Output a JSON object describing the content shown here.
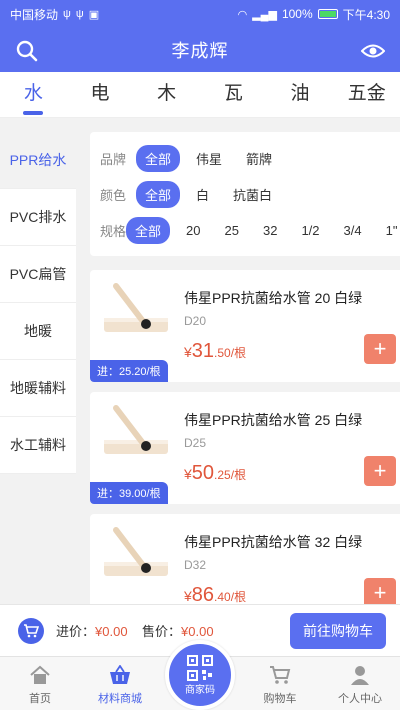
{
  "status_bar": {
    "carrier": "中国移动",
    "battery": "100%",
    "time": "下午4:30"
  },
  "header": {
    "title": "李成辉"
  },
  "category_tabs": [
    "水",
    "电",
    "木",
    "瓦",
    "油",
    "五金"
  ],
  "sidebar": {
    "items": [
      "PPR给水",
      "PVC排水",
      "PVC扁管",
      "地暖",
      "地暖辅料",
      "水工辅料"
    ]
  },
  "filters": {
    "brand": {
      "label": "品牌",
      "options": [
        "全部",
        "伟星",
        "箭牌"
      ]
    },
    "color": {
      "label": "颜色",
      "options": [
        "全部",
        "白",
        "抗菌白"
      ]
    },
    "spec": {
      "label": "规格",
      "options": [
        "全部",
        "20",
        "25",
        "32",
        "1/2",
        "3/4",
        "1\""
      ]
    }
  },
  "products": [
    {
      "name": "伟星PPR抗菌给水管 20 白绿",
      "code": "D20",
      "currency": "¥",
      "price_int": "31",
      "price_rest": ".50/根",
      "cost": "进：25.20/根"
    },
    {
      "name": "伟星PPR抗菌给水管 25 白绿",
      "code": "D25",
      "currency": "¥",
      "price_int": "50",
      "price_rest": ".25/根",
      "cost": "进：39.00/根"
    },
    {
      "name": "伟星PPR抗菌给水管 32 白绿",
      "code": "D32",
      "currency": "¥",
      "price_int": "86",
      "price_rest": ".40/根",
      "cost": ""
    }
  ],
  "add_symbol": "+",
  "cart_bar": {
    "cost_label": "进价：",
    "cost_value": "¥0.00",
    "sale_label": "售价：",
    "sale_value": "¥0.00",
    "checkout_label": "前往购物车"
  },
  "bottom_nav": {
    "home": "首页",
    "mall": "材料商城",
    "qr": "商家码",
    "cart": "购物车",
    "profile": "个人中心"
  },
  "colors": {
    "primary": "#5a6ff0",
    "accent_blue": "#4a63e8",
    "price_red": "#e0563b",
    "add_button": "#f0826b"
  }
}
